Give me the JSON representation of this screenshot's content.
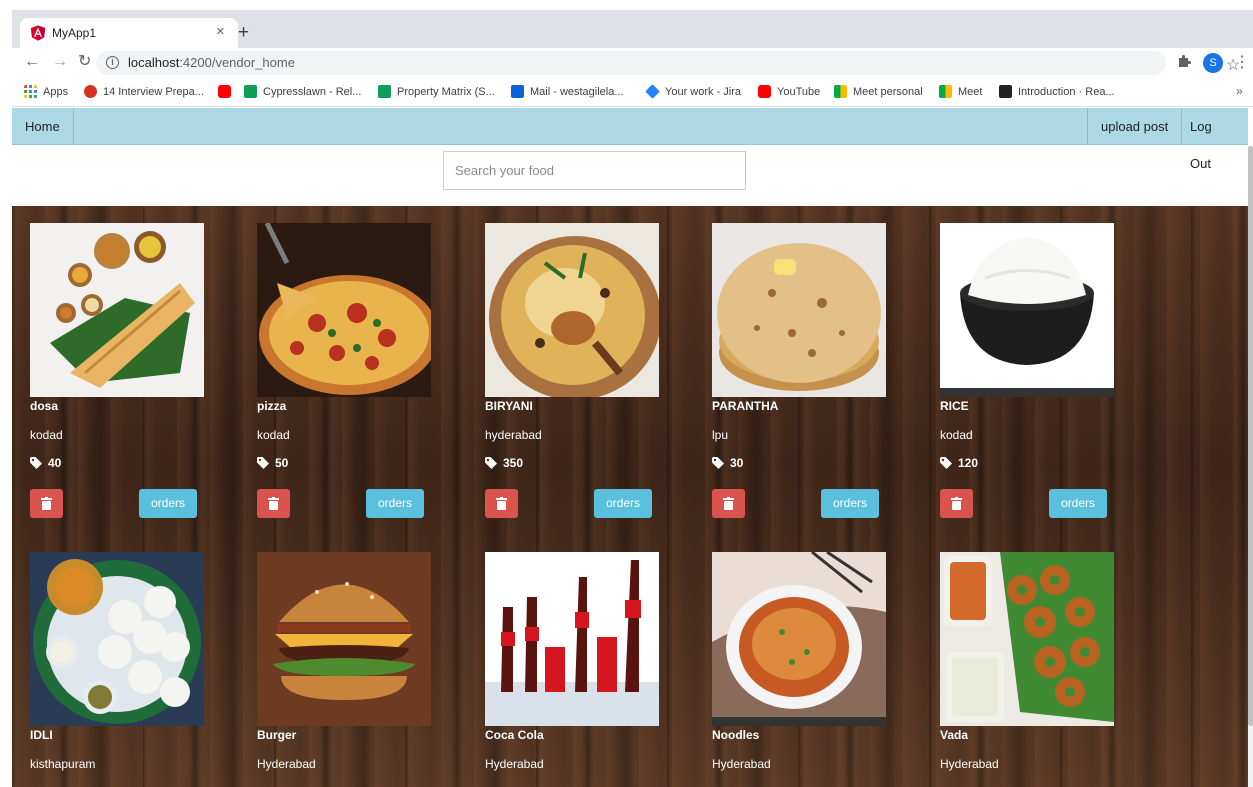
{
  "browser": {
    "tab_title": "MyApp1",
    "tab_close": "×",
    "new_tab": "+",
    "url_host": "localhost",
    "url_path": ":4200/vendor_home",
    "bookmarks": [
      "Apps",
      "14 Interview Prepa...",
      "Cypresslawn - Rel...",
      "Property Matrix (S...",
      "Mail - westagilela...",
      "Your work - Jira",
      "YouTube",
      "Meet personal",
      "Meet",
      "Introduction · Rea..."
    ],
    "bookmarks_more": "»",
    "profile_initial": "S"
  },
  "navbar": {
    "home": "Home",
    "upload_post": "upload post",
    "logout": "Log Out"
  },
  "search": {
    "placeholder": "Search your food"
  },
  "buttons": {
    "orders_label": "orders"
  },
  "foods": [
    {
      "name": "dosa",
      "city": "kodad",
      "price": "40"
    },
    {
      "name": "pizza",
      "city": "kodad",
      "price": "50"
    },
    {
      "name": "BIRYANI",
      "city": "hyderabad",
      "price": "350"
    },
    {
      "name": "PARANTHA",
      "city": "lpu",
      "price": "30"
    },
    {
      "name": "RICE",
      "city": "kodad",
      "price": "120"
    },
    {
      "name": "IDLI",
      "city": "kisthapuram"
    },
    {
      "name": "Burger",
      "city": "Hyderabad"
    },
    {
      "name": "Coca Cola",
      "city": "Hyderabad"
    },
    {
      "name": "Noodles",
      "city": "Hyderabad"
    },
    {
      "name": "Vada",
      "city": "Hyderabad"
    }
  ],
  "colors": {
    "navbar": "#add8e6",
    "delete_button": "#d9534f",
    "orders_button": "#5bc0de"
  }
}
